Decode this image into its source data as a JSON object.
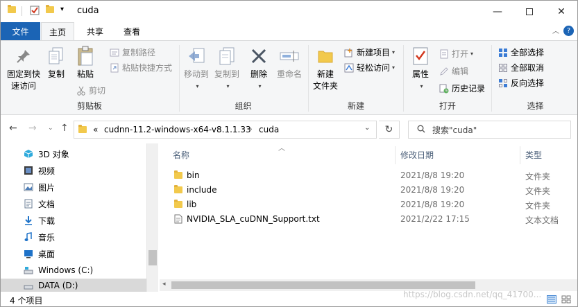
{
  "window": {
    "title": "cuda",
    "minimize_icon": "minimize-icon",
    "maximize_icon": "maximize-icon",
    "close_icon": "close-icon"
  },
  "menu": {
    "file": "文件",
    "home": "主页",
    "share": "共享",
    "view": "查看"
  },
  "ribbon": {
    "clipboard": {
      "label": "剪贴板",
      "pin": "固定到快速访问",
      "pin_l1": "固定到快",
      "pin_l2": "速访问",
      "copy": "复制",
      "paste": "粘贴",
      "copy_path": "复制路径",
      "paste_shortcut": "粘贴快捷方式",
      "cut": "剪切"
    },
    "organize": {
      "label": "组织",
      "move_to": "移动到",
      "copy_to": "复制到",
      "delete": "删除",
      "rename": "重命名"
    },
    "new": {
      "label": "新建",
      "new_folder_l1": "新建",
      "new_folder_l2": "文件夹",
      "new_item": "新建项目",
      "easy_access": "轻松访问"
    },
    "open": {
      "label": "打开",
      "properties": "属性",
      "open": "打开",
      "edit": "编辑",
      "history": "历史记录"
    },
    "select": {
      "label": "选择",
      "select_all": "全部选择",
      "select_none": "全部取消",
      "invert": "反向选择"
    }
  },
  "address": {
    "overflow": "«",
    "crumb1": "cudnn-11.2-windows-x64-v8.1.1.33",
    "sep": "›",
    "crumb2": "cuda",
    "search_placeholder": "搜索\"cuda\""
  },
  "nav": {
    "items": [
      {
        "label": "3D 对象",
        "icon": "3d-objects-icon"
      },
      {
        "label": "视频",
        "icon": "video-icon"
      },
      {
        "label": "图片",
        "icon": "pictures-icon"
      },
      {
        "label": "文档",
        "icon": "documents-icon"
      },
      {
        "label": "下载",
        "icon": "downloads-icon"
      },
      {
        "label": "音乐",
        "icon": "music-icon"
      },
      {
        "label": "桌面",
        "icon": "desktop-icon"
      },
      {
        "label": "Windows (C:)",
        "icon": "drive-icon"
      },
      {
        "label": "DATA (D:)",
        "icon": "drive-icon"
      }
    ]
  },
  "columns": {
    "name": "名称",
    "date": "修改日期",
    "type": "类型"
  },
  "files": [
    {
      "name": "bin",
      "date": "2021/8/8 19:20",
      "type": "文件夹",
      "kind": "folder"
    },
    {
      "name": "include",
      "date": "2021/8/8 19:20",
      "type": "文件夹",
      "kind": "folder"
    },
    {
      "name": "lib",
      "date": "2021/8/8 19:20",
      "type": "文件夹",
      "kind": "folder"
    },
    {
      "name": "NVIDIA_SLA_cuDNN_Support.txt",
      "date": "2021/2/22 17:15",
      "type": "文本文档",
      "kind": "text"
    }
  ],
  "status": {
    "count": "4 个项目"
  },
  "watermark": "https://blog.csdn.net/qq_41700..."
}
